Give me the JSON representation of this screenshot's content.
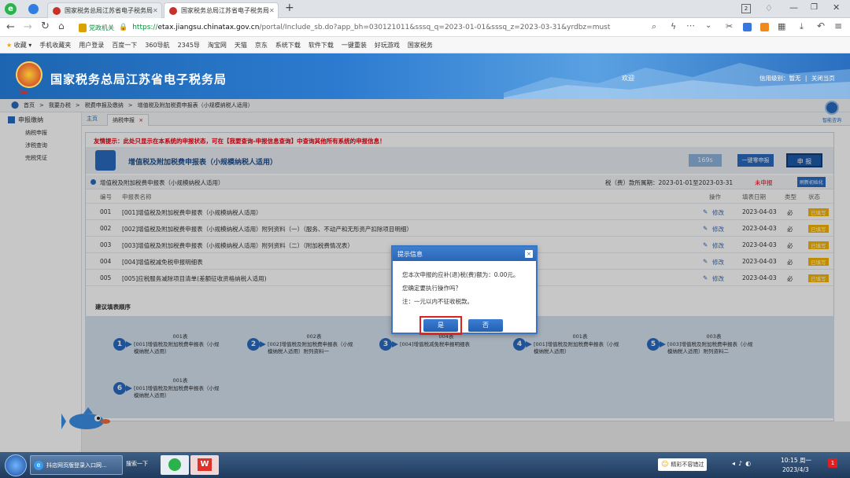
{
  "browser": {
    "tabs": [
      {
        "title": "国家税务总局江苏省电子税务局"
      },
      {
        "title": "国家税务总局江苏省电子税务局"
      }
    ],
    "new_tab": "+",
    "url_prefix": "https://",
    "url_domain": "etax.jiangsu.chinatax.gov.cn",
    "url_rest": "/portal/Include_sb.do?app_bh=030121011&sssq_q=2023-01-01&sssq_z=2023-03-31&yrdbz=must",
    "security_badge": "党政机关",
    "window_badge": "2",
    "bookmarks": [
      "收藏",
      "手机收藏夹",
      "用户登录",
      "百度一下",
      "360导航",
      "2345导",
      "淘宝网",
      "天猫",
      "京东",
      "系统下载",
      "软件下载",
      "一键重装",
      "好玩游戏",
      "国家税务"
    ]
  },
  "header": {
    "site_title": "国家税务总局江苏省电子税务局",
    "welcome": "欢迎",
    "credit_level": "信用级别：暂无",
    "separator": "|",
    "close_page": "关闭当页",
    "logo_text": "Tax"
  },
  "breadcrumb": [
    "首页",
    ">",
    "我要办税",
    ">",
    "税费申报及缴纳",
    ">",
    "增值税及附加税费申报表（小规模纳税人适用）"
  ],
  "help": "智能咨询",
  "sidebar": {
    "title": "申报缴纳",
    "items": [
      "纳税申报",
      "涉税查询",
      "完税凭证"
    ]
  },
  "page_tabs": [
    {
      "label": "主页"
    },
    {
      "label": "纳税申报",
      "close": "×"
    }
  ],
  "main": {
    "tip": "友情提示：此处只显示在本系统的申报状态，可在【我要查询-申报信息查询】中查询其他所有系统的申报信息！",
    "form_title": "增值税及附加税费申报表（小规模纳税人适用）",
    "timer": "169s",
    "one_click_zero": "一键零申报",
    "declare": "申 报",
    "subheader": "增值税及附加税费申报表（小规模纳税人适用）",
    "period": "税（费）款所属期：2023-01-01至2023-03-31",
    "status": "未申报",
    "refresh": "刷新初始化",
    "columns": [
      "编号",
      "申报表名称",
      "操作",
      "填表日期",
      "类型",
      "状态"
    ],
    "rows": [
      {
        "no": "001",
        "name": "[001]增值税及附加税费申报表（小规模纳税人适用）",
        "op": "修改",
        "date": "2023-04-03",
        "type": "必",
        "status": "已填写"
      },
      {
        "no": "002",
        "name": "[002]增值税及附加税费申报表（小规模纳税人适用）附列资料（一）（服务、不动产和无形资产扣除项目明细）",
        "op": "修改",
        "date": "2023-04-03",
        "type": "必",
        "status": "已填写"
      },
      {
        "no": "003",
        "name": "[003]增值税及附加税费申报表（小规模纳税人适用）附列资料（二）（附加税费情况表）",
        "op": "修改",
        "date": "2023-04-03",
        "type": "必",
        "status": "已填写"
      },
      {
        "no": "004",
        "name": "[004]增值税减免税申报明细表",
        "op": "修改",
        "date": "2023-04-03",
        "type": "必",
        "status": "已填写"
      },
      {
        "no": "005",
        "name": "[005]应税服务减除项目清单(差额征收资格纳税人适用)",
        "op": "修改",
        "date": "2023-04-03",
        "type": "必",
        "status": "已填写"
      }
    ],
    "steps_title": "建议填表顺序",
    "steps": [
      {
        "num": "1",
        "head": "001表",
        "text": "[001]增值税及附加税费申报表（小规模纳税人适用）"
      },
      {
        "num": "2",
        "head": "002表",
        "text": "[002]增值税及附加税费申报表（小规模纳税人适用）附列资料一"
      },
      {
        "num": "3",
        "head": "004表",
        "text": "[004]增值税减免税申报明细表"
      },
      {
        "num": "4",
        "head": "001表",
        "text": "[001]增值税及附加税费申报表（小规模纳税人适用）"
      },
      {
        "num": "5",
        "head": "003表",
        "text": "[003]增值税及附加税费申报表（小规模纳税人适用）附列资料二"
      },
      {
        "num": "6",
        "head": "001表",
        "text": "[001]增值税及附加税费申报表（小规模纳税人适用）"
      }
    ]
  },
  "dialog": {
    "title": "提示信息",
    "close": "×",
    "line1": "您本次申报的应补(退)税(费)额为：0.00元。",
    "line2": "您确定要执行操作吗？",
    "line3": "注：一元以内不征收税款。",
    "yes": "是",
    "no": "否"
  },
  "taskbar": {
    "task1": "抖店网页版登录入口网...",
    "search": "搜索一下",
    "ime": "精彩不容错过",
    "time": "10:15 周一",
    "date": "2023/4/3",
    "notif": "1"
  },
  "colors": {
    "accent": "#2a6bbf",
    "warning": "#e60012",
    "status": "#f6b400"
  }
}
